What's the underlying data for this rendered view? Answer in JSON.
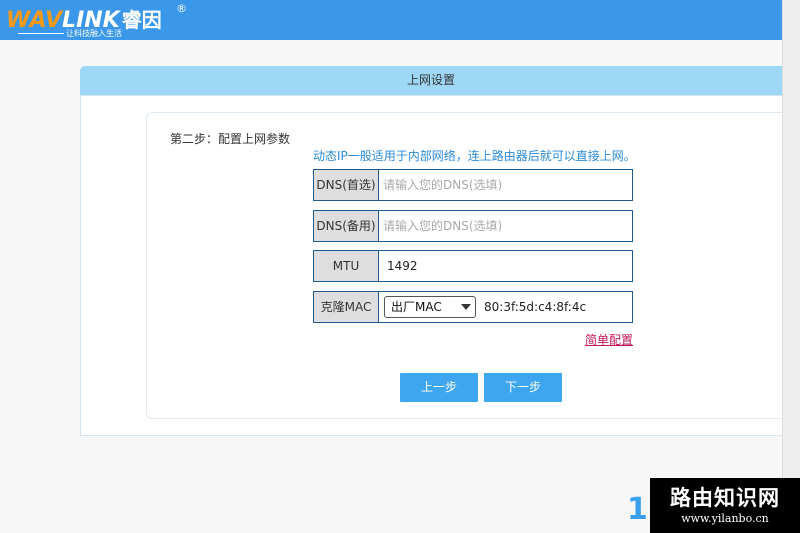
{
  "header": {
    "logo_w": "WAV",
    "logo_rest": "LINK",
    "logo_cn": "睿因",
    "logo_reg": "®",
    "slogan": "让科技融入生活"
  },
  "panel": {
    "title": "上网设置",
    "step_label": "第二步：配置上网参数",
    "hint": "动态IP一般适用于内部网络，连上路由器后就可以直接上网。"
  },
  "fields": {
    "dns_primary": {
      "label": "DNS(首选)",
      "placeholder": "请输入您的DNS(选填)"
    },
    "dns_backup": {
      "label": "DNS(备用)",
      "placeholder": "请输入您的DNS(选填)"
    },
    "mtu": {
      "label": "MTU",
      "value": "1492"
    },
    "clone_mac": {
      "label": "克隆MAC",
      "select_value": "出厂MAC",
      "mac": "80:3f:5d:c4:8f:4c"
    }
  },
  "links": {
    "simple_config": "简单配置"
  },
  "buttons": {
    "prev": "上一步",
    "next": "下一步"
  },
  "watermark": {
    "title": "路由知识网",
    "url": "www.yilanbo.cn"
  },
  "bottom_glyph": "1",
  "colors": {
    "header_bg": "#3a97ea",
    "panel_header_bg": "#9ed8f7",
    "button_bg": "#3ea6f0",
    "hint_color": "#2b8ad9",
    "link_color": "#c2185b",
    "field_border": "#1e5b93"
  },
  "icons": {
    "select_arrow": "chevron-down-icon"
  }
}
